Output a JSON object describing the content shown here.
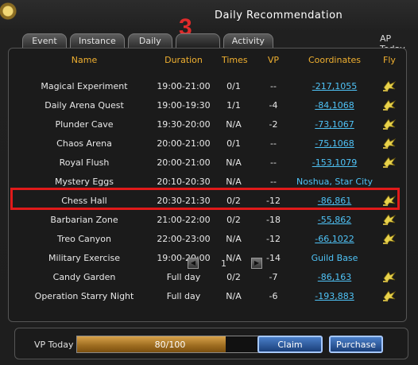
{
  "window": {
    "title": "Daily Recommendation",
    "step_badge": "3",
    "ap_today_label": "AP Today"
  },
  "tabs": [
    {
      "label": "Event"
    },
    {
      "label": "Instance"
    },
    {
      "label": "Daily"
    },
    {
      "label": ""
    },
    {
      "label": "Activity"
    }
  ],
  "table": {
    "headers": {
      "name": "Name",
      "duration": "Duration",
      "times": "Times",
      "vp": "VP",
      "coordinates": "Coordinates",
      "fly": "Fly"
    },
    "rows": [
      {
        "name": "Magical Experiment",
        "duration": "19:00-21:00",
        "times": "0/1",
        "vp": "--",
        "coordinates": "-217,1055",
        "coord_link": true,
        "fly": "fly-icon"
      },
      {
        "name": "Daily Arena Quest",
        "duration": "19:00-19:30",
        "times": "1/1",
        "vp": "-4",
        "coordinates": "-84,1068",
        "coord_link": true,
        "fly": "fly-icon"
      },
      {
        "name": "Plunder Cave",
        "duration": "19:30-20:00",
        "times": "N/A",
        "vp": "-2",
        "coordinates": "-73,1067",
        "coord_link": true,
        "fly": "fly-icon"
      },
      {
        "name": "Chaos Arena",
        "duration": "20:00-21:00",
        "times": "0/1",
        "vp": "--",
        "coordinates": "-75,1068",
        "coord_link": true,
        "fly": "fly-icon"
      },
      {
        "name": "Royal Flush",
        "duration": "20:00-21:00",
        "times": "N/A",
        "vp": "--",
        "coordinates": "-153,1079",
        "coord_link": true,
        "fly": "fly-icon"
      },
      {
        "name": "Mystery Eggs",
        "duration": "20:10-20:30",
        "times": "N/A",
        "vp": "--",
        "coordinates": "Noshua, Star City",
        "coord_link": false,
        "fly": ""
      },
      {
        "name": "Chess Hall",
        "duration": "20:30-21:30",
        "times": "0/2",
        "vp": "-12",
        "coordinates": "-86,861",
        "coord_link": true,
        "fly": "fly-icon"
      },
      {
        "name": "Barbarian Zone",
        "duration": "21:00-22:00",
        "times": "0/2",
        "vp": "-18",
        "coordinates": "-55,862",
        "coord_link": true,
        "fly": "fly-icon"
      },
      {
        "name": "Treo Canyon",
        "duration": "22:00-23:00",
        "times": "N/A",
        "vp": "-12",
        "coordinates": "-66,1022",
        "coord_link": true,
        "fly": "fly-icon"
      },
      {
        "name": "Military Exercise",
        "duration": "19:00-20:00",
        "times": "N/A",
        "vp": "-14",
        "coordinates": "Guild Base",
        "coord_link": false,
        "fly": ""
      },
      {
        "name": "Candy Garden",
        "duration": "Full day",
        "times": "0/2",
        "vp": "-7",
        "coordinates": "-86,163",
        "coord_link": true,
        "fly": "fly-icon"
      },
      {
        "name": "Operation Starry Night",
        "duration": "Full day",
        "times": "N/A",
        "vp": "-6",
        "coordinates": "-193,883",
        "coord_link": true,
        "fly": "fly-icon"
      }
    ]
  },
  "pager": {
    "prev_icon": "prev-page-icon",
    "page": "1",
    "next_icon": "next-page-icon"
  },
  "vp_bar": {
    "label": "VP Today",
    "text": "80/100",
    "fill_fraction": 0.8
  },
  "buttons": {
    "claim": "Claim",
    "purchase": "Purchase"
  },
  "colors": {
    "header": "#f0b030",
    "link": "#4fc3f7",
    "highlight": "#e01a1a",
    "bar": "#c98a2e"
  }
}
